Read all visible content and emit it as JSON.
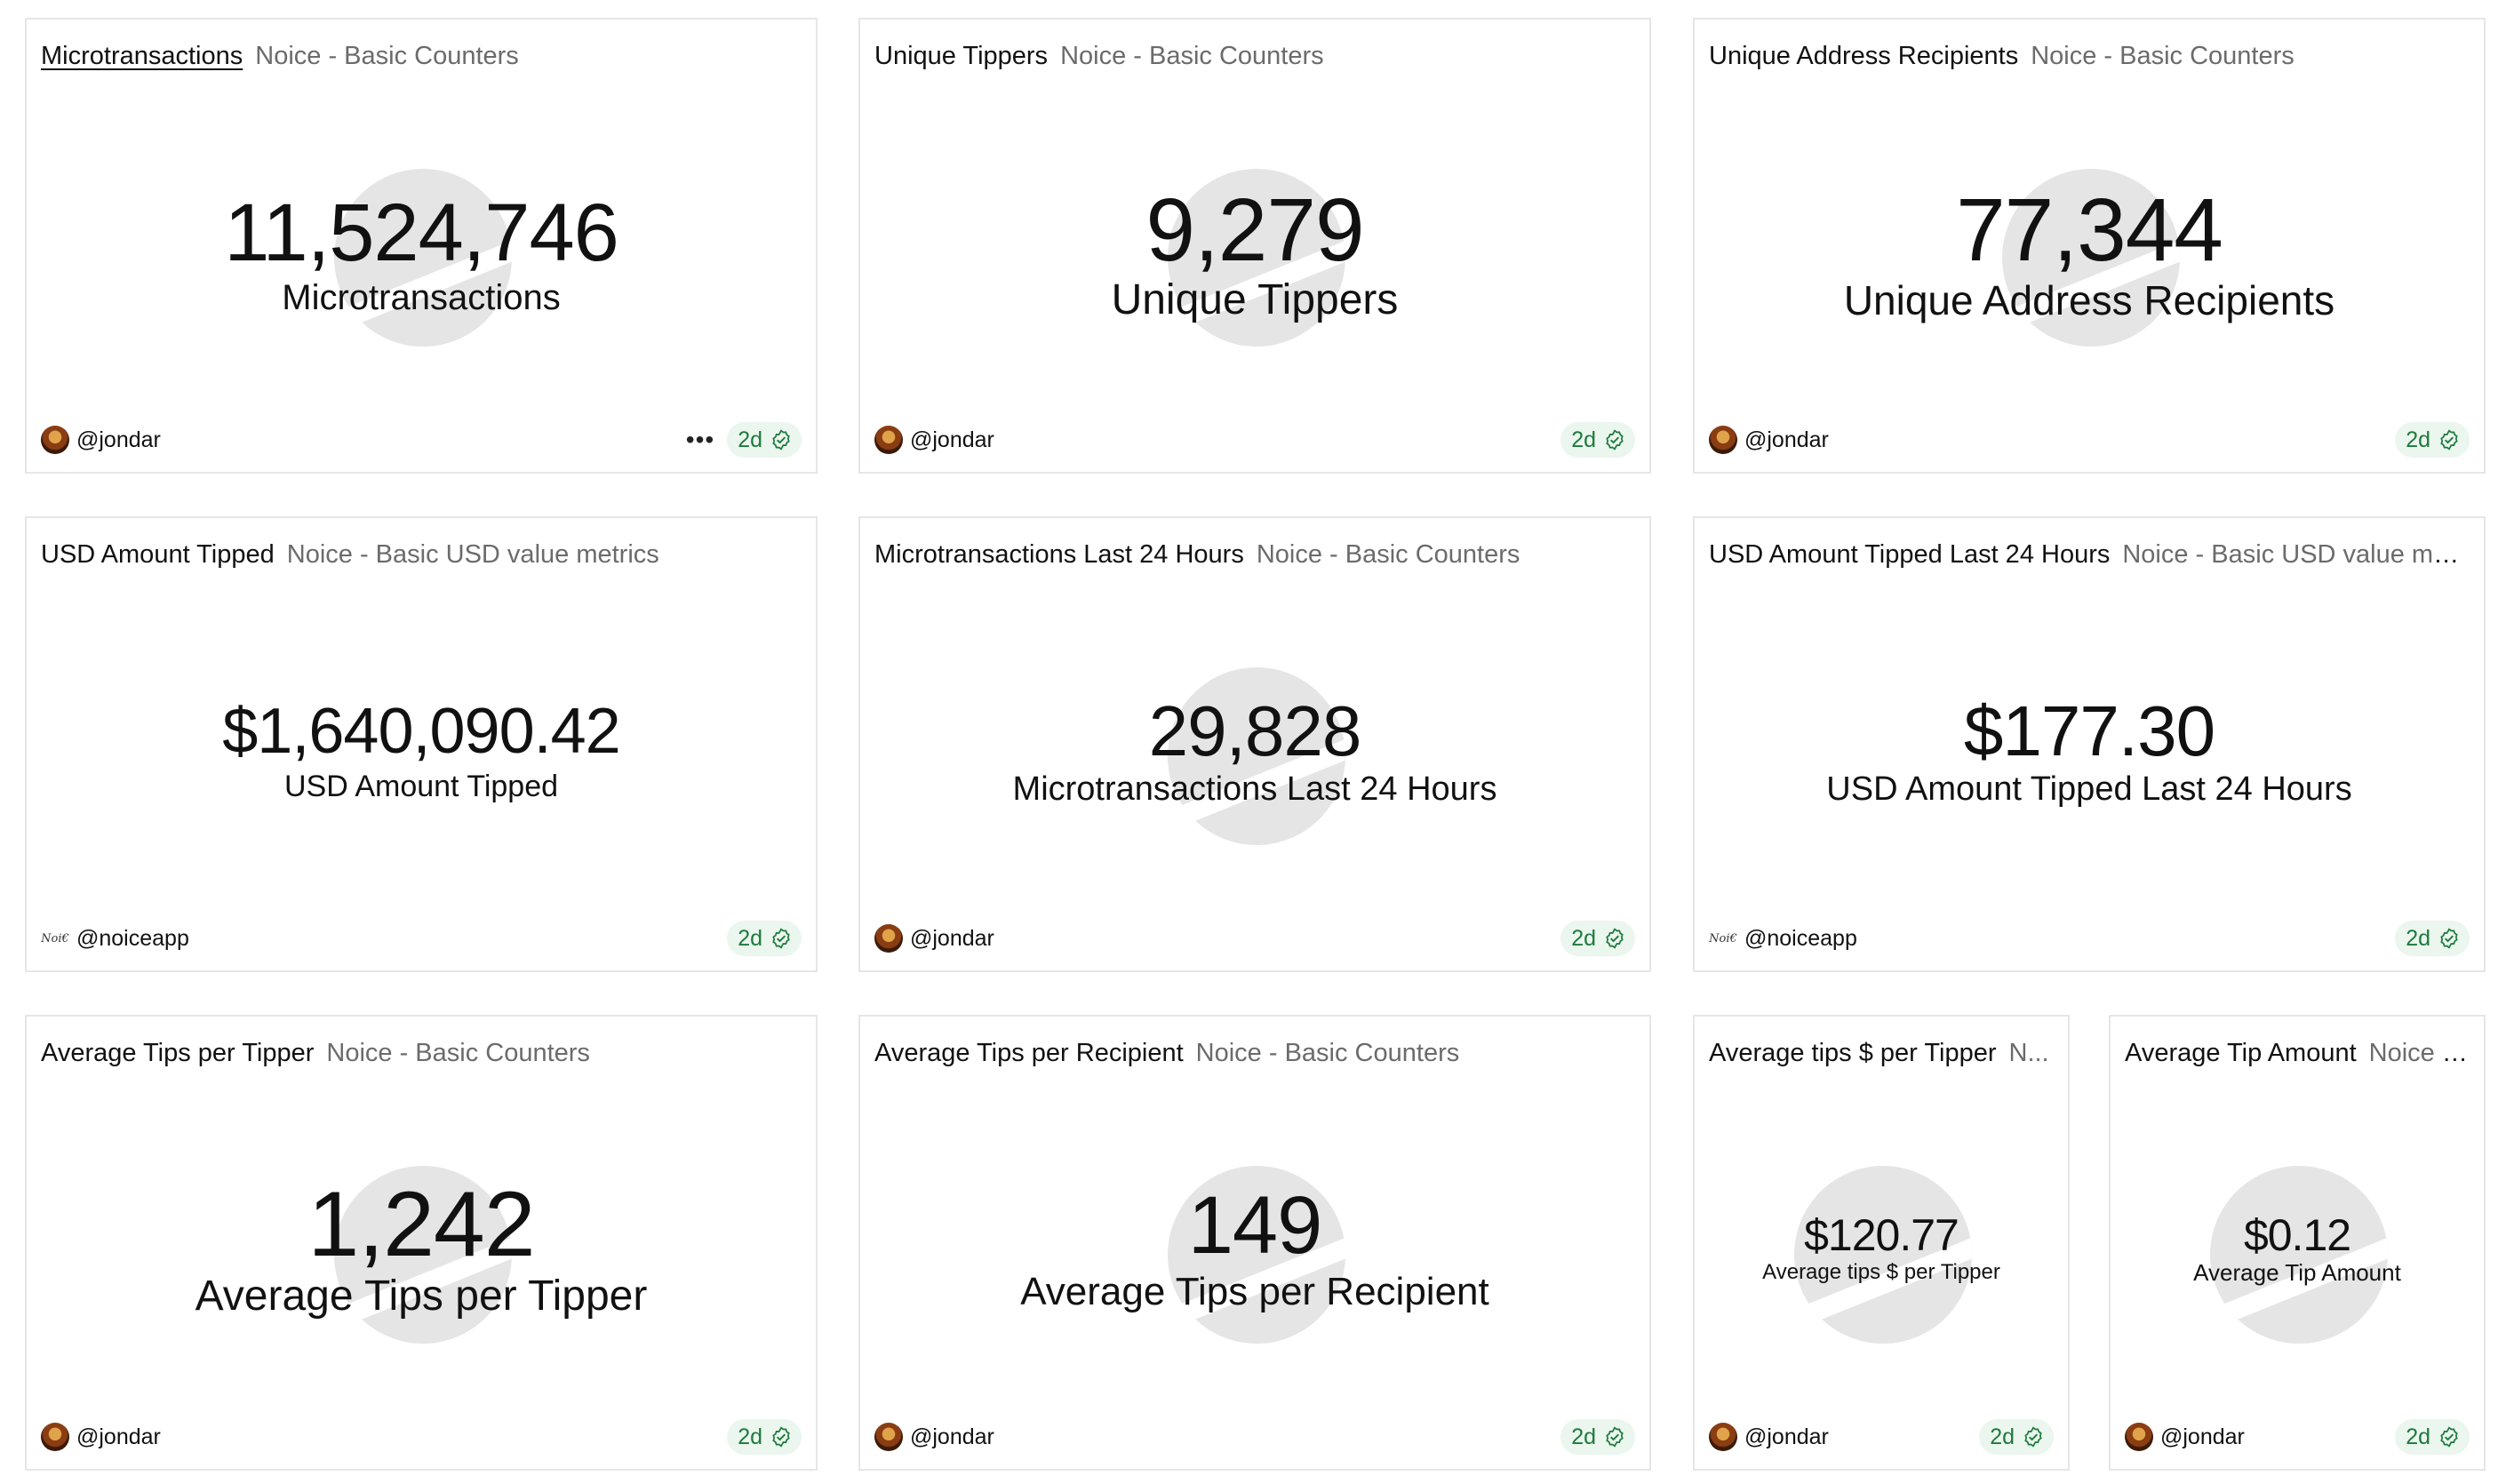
{
  "cards": [
    {
      "title": "Microtransactions",
      "subtitle": "Noice - Basic Counters",
      "value": "11,524,746",
      "label": "Microtransactions",
      "author": "@jondar",
      "age": "2d",
      "avatar": "avatar-icon",
      "has_menu": true
    },
    {
      "title": "Unique Tippers",
      "subtitle": "Noice - Basic Counters",
      "value": "9,279",
      "label": "Unique Tippers",
      "author": "@jondar",
      "age": "2d",
      "avatar": "avatar-icon"
    },
    {
      "title": "Unique Address Recipients",
      "subtitle": "Noice - Basic Counters",
      "value": "77,344",
      "label": "Unique Address Recipients",
      "author": "@jondar",
      "age": "2d",
      "avatar": "avatar-icon"
    },
    {
      "title": "USD Amount Tipped",
      "subtitle": "Noice - Basic USD value metrics",
      "value": "$1,640,090.42",
      "label": "USD Amount Tipped",
      "author": "@noiceapp",
      "age": "2d",
      "avatar": "noice-logo-icon"
    },
    {
      "title": "Microtransactions Last 24 Hours",
      "subtitle": "Noice - Basic Counters",
      "value": "29,828",
      "label": "Microtransactions Last 24 Hours",
      "author": "@jondar",
      "age": "2d",
      "avatar": "avatar-icon"
    },
    {
      "title": "USD Amount Tipped Last 24 Hours",
      "subtitle": "Noice - Basic USD value metr...",
      "value": "$177.30",
      "label": "USD Amount Tipped Last 24 Hours",
      "author": "@noiceapp",
      "age": "2d",
      "avatar": "noice-logo-icon"
    },
    {
      "title": "Average Tips per Tipper",
      "subtitle": "Noice - Basic Counters",
      "value": "1,242",
      "label": "Average Tips per Tipper",
      "author": "@jondar",
      "age": "2d",
      "avatar": "avatar-icon"
    },
    {
      "title": "Average Tips per Recipient",
      "subtitle": "Noice - Basic Counters",
      "value": "149",
      "label": "Average Tips per Recipient",
      "author": "@jondar",
      "age": "2d",
      "avatar": "avatar-icon"
    },
    {
      "title": "Average tips $ per Tipper",
      "subtitle": "N...",
      "value": "$120.77",
      "label": "Average tips $ per Tipper",
      "author": "@jondar",
      "age": "2d",
      "avatar": "avatar-icon"
    },
    {
      "title": "Average Tip Amount",
      "subtitle": "Noice -...",
      "value": "$0.12",
      "label": "Average Tip Amount",
      "author": "@jondar",
      "age": "2d",
      "avatar": "avatar-icon"
    }
  ],
  "colors": {
    "badge_bg": "#eaf6ee",
    "badge_text": "#1e7a3c",
    "watermark": "#e5e5e5",
    "card_border": "#e6e6e6"
  },
  "icons": {
    "badge": "check-circle-icon",
    "menu": "more-dots-icon",
    "watermark": "dune-logo-watermark"
  }
}
